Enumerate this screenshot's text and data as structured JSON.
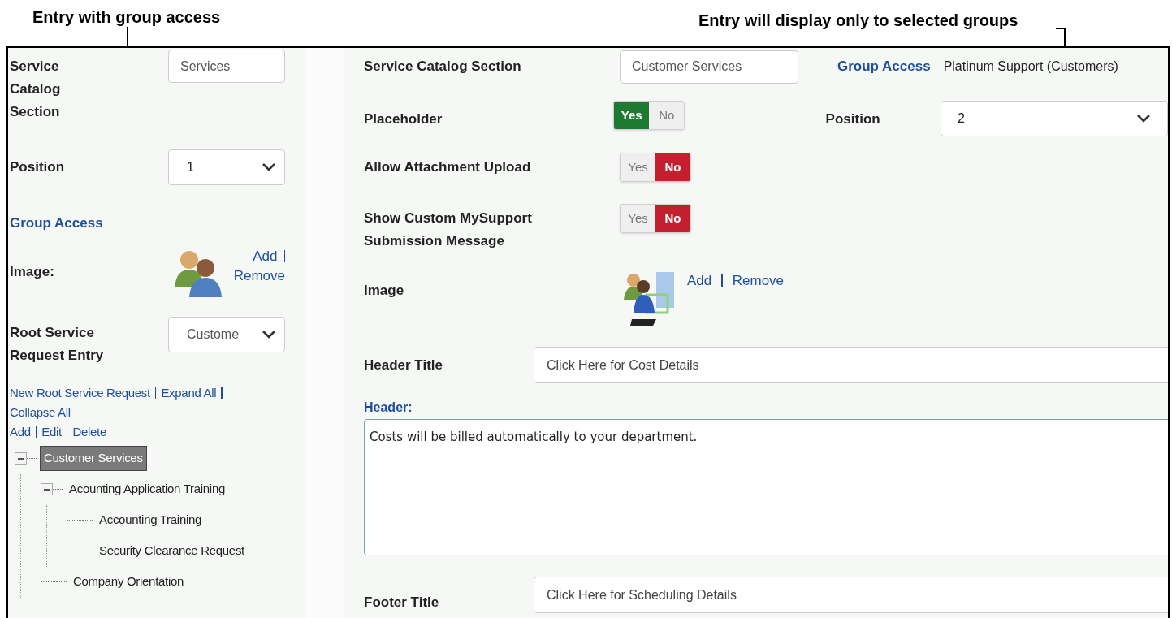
{
  "callouts": [
    {
      "text": "Entry with group access"
    },
    {
      "text": "Entry will display only to selected groups"
    }
  ],
  "left_panel": {
    "service_catalog_section": {
      "label": "Service Catalog Section",
      "value": "Services"
    },
    "position": {
      "label": "Position",
      "value": "1"
    },
    "group_access": {
      "label": "Group Access"
    },
    "image": {
      "label": "Image:",
      "links": [
        "Add",
        "Remove"
      ]
    },
    "root_service_request_entry": {
      "label": "Root Service Request Entry",
      "value": "Custome"
    },
    "tree_links": [
      "New Root Service Request",
      "Expand All",
      "Collapse All"
    ],
    "node_links": [
      "Add",
      "Edit",
      "Delete"
    ],
    "tree": [
      {
        "label": "Customer Services",
        "selected": true,
        "expanded": true,
        "children": [
          {
            "label": "Acounting Application Training",
            "selected": false,
            "expanded": true,
            "children": [
              {
                "label": "Accounting Training",
                "selected": false
              },
              {
                "label": "Security Clearance Request",
                "selected": false
              }
            ]
          },
          {
            "label": "Company Orientation",
            "selected": false
          }
        ]
      }
    ]
  },
  "form": {
    "service_catalog_section": {
      "label": "Service Catalog Section",
      "value": "Customer Services"
    },
    "group_access": {
      "label": "Group Access",
      "value": "Platinum Support (Customers)"
    },
    "position": {
      "label": "Position",
      "value": "2"
    },
    "toggles": [
      {
        "label": "Placeholder",
        "options": [
          {
            "label": "Yes",
            "selected": true
          },
          {
            "label": "No",
            "selected": false
          }
        ]
      },
      {
        "label": "Allow Attachment Upload",
        "options": [
          {
            "label": "Yes",
            "selected": false
          },
          {
            "label": "No",
            "selected": true
          }
        ]
      },
      {
        "label": "Show Custom MySupport Submission Message",
        "options": [
          {
            "label": "Yes",
            "selected": false
          },
          {
            "label": "No",
            "selected": true
          }
        ]
      }
    ],
    "image": {
      "label": "Image",
      "links": [
        "Add",
        "Remove"
      ]
    },
    "header_title": {
      "label": "Header Title",
      "value": "Click Here for Cost Details"
    },
    "header": {
      "label": "Header:",
      "value": "Costs will be billed automatically to your department."
    },
    "footer_title": {
      "label": "Footer Title",
      "value": "Click Here for Scheduling Details"
    }
  }
}
